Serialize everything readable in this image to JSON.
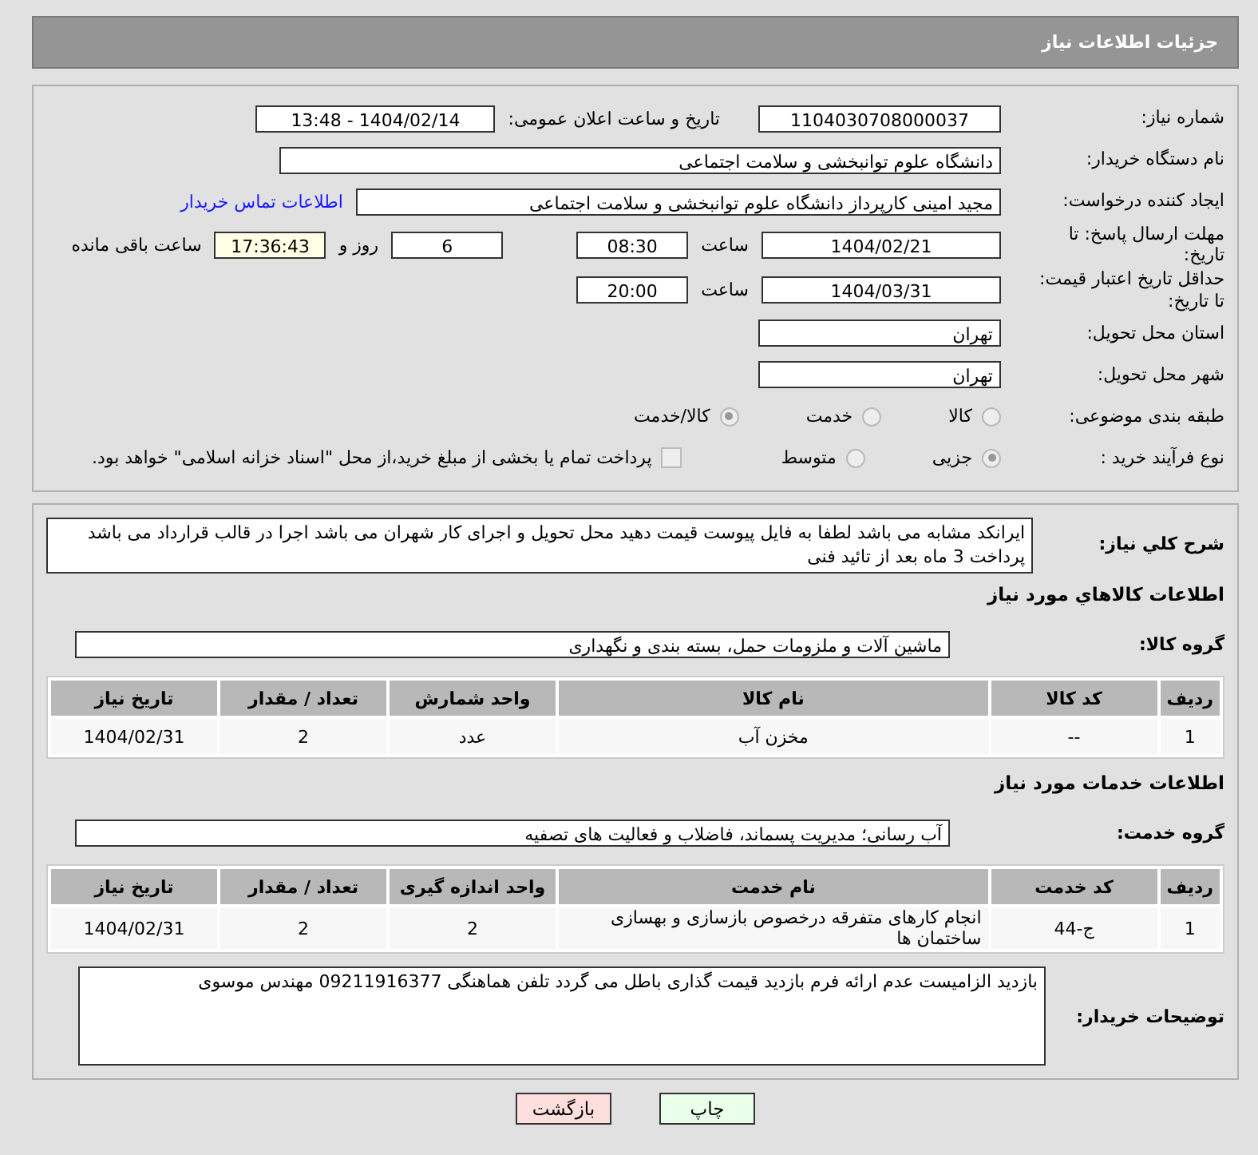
{
  "header": {
    "title": "جزئیات اطلاعات نیاز"
  },
  "need_number": {
    "label": "شماره نیاز:",
    "value": "1104030708000037"
  },
  "announce": {
    "label": "تاریخ و ساعت اعلان عمومی:",
    "value": "1404/02/14 - 13:48"
  },
  "buyer_org": {
    "label": "نام دستگاه خریدار:",
    "value": "دانشگاه علوم توانبخشی و سلامت اجتماعی"
  },
  "requester": {
    "label": "ایجاد کننده درخواست:",
    "value": "مجید امینی کارپرداز دانشگاه علوم توانبخشی و سلامت اجتماعی",
    "link": "اطلاعات تماس خریدار"
  },
  "deadline": {
    "label": "مهلت ارسال پاسخ: تا تاریخ:",
    "date": "1404/02/21",
    "time_label": "ساعت",
    "time": "08:30",
    "days": "6",
    "days_label": "روز و",
    "remaining": "17:36:43",
    "remaining_label": "ساعت باقی مانده"
  },
  "validity": {
    "label": "حداقل تاریخ اعتبار قیمت: تا تاریخ:",
    "date": "1404/03/31",
    "time_label": "ساعت",
    "time": "20:00"
  },
  "province": {
    "label": "استان محل تحویل:",
    "value": "تهران"
  },
  "city": {
    "label": "شهر محل تحویل:",
    "value": "تهران"
  },
  "category": {
    "label": "طبقه بندی موضوعی:",
    "options": [
      {
        "label": "کالا",
        "selected": false
      },
      {
        "label": "خدمت",
        "selected": false
      },
      {
        "label": "کالا/خدمت",
        "selected": true
      }
    ]
  },
  "process": {
    "label": "نوع فرآیند خرید :",
    "options": [
      {
        "label": "جزیی",
        "selected": true
      },
      {
        "label": "متوسط",
        "selected": false
      }
    ],
    "payment": {
      "label": "پرداخت تمام یا بخشی از مبلغ خرید،از محل \"اسناد خزانه اسلامی\" خواهد بود.",
      "checked": false
    }
  },
  "description": {
    "label": "شرح کلي نياز:",
    "text": "ایرانکد مشابه می باشد لطفا به فایل پیوست قیمت دهید محل تحویل و اجرای کار شهران می باشد اجرا در قالب قرارداد می باشد  پرداخت 3 ماه بعد از تائید فنی"
  },
  "goods": {
    "title": "اطلاعات کالاهاي مورد نياز",
    "group_label": "گروه کالا:",
    "group_value": "ماشین آلات و ملزومات حمل، بسته بندی و نگهداری",
    "columns": [
      "ردیف",
      "کد کالا",
      "نام کالا",
      "واحد شمارش",
      "تعداد / مقدار",
      "تاریخ نیاز"
    ],
    "rows": [
      [
        "1",
        "--",
        "مخزن آب",
        "عدد",
        "2",
        "1404/02/31"
      ]
    ]
  },
  "services": {
    "title": "اطلاعات خدمات مورد نیاز",
    "group_label": "گروه خدمت:",
    "group_value": "آب رسانی؛ مدیریت پسماند، فاضلاب و فعالیت های تصفیه",
    "columns": [
      "ردیف",
      "کد خدمت",
      "نام خدمت",
      "واحد اندازه گیری",
      "تعداد / مقدار",
      "تاریخ نیاز"
    ],
    "rows": [
      [
        "1",
        "ج-44",
        "انجام کارهای متفرقه درخصوص بازسازی و بهسازی ساختمان ها",
        "2",
        "2",
        "1404/02/31"
      ]
    ]
  },
  "buyer_notes": {
    "label": "توضیحات خریدار:",
    "text": "بازدید الزامیست عدم ارائه فرم بازدید قیمت گذاری باطل می گردد   تلفن هماهنگی 09211916377 مهندس موسوی"
  },
  "buttons": [
    {
      "label": "چاپ",
      "kind": "print"
    },
    {
      "label": "بازگشت",
      "kind": "back"
    }
  ]
}
